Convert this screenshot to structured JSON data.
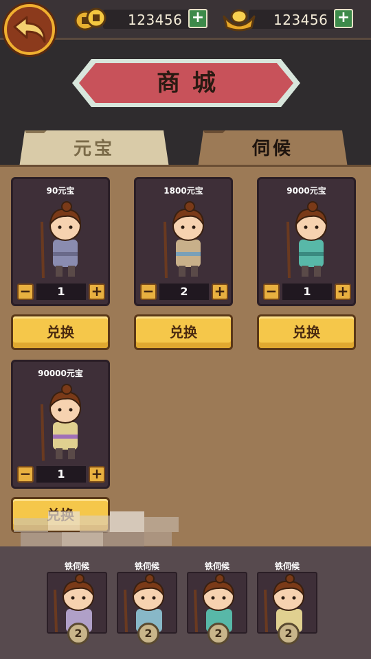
{
  "header": {
    "coins": "123456",
    "ingots": "123456",
    "add_symbol": "+"
  },
  "title": "商城",
  "tabs": [
    {
      "label": "元宝",
      "active": false
    },
    {
      "label": "伺候",
      "active": true
    }
  ],
  "shop": {
    "items": [
      {
        "price": "90元宝",
        "qty": "1",
        "robe": "#8a8cb0",
        "sash": "#6a6a8a"
      },
      {
        "price": "1800元宝",
        "qty": "2",
        "robe": "#c8b08a",
        "sash": "#7aa0b8"
      },
      {
        "price": "9000元宝",
        "qty": "1",
        "robe": "#58b8a8",
        "sash": "#3a8a80"
      },
      {
        "price": "90000元宝",
        "qty": "1",
        "robe": "#e0d090",
        "sash": "#a070b8"
      }
    ],
    "exchange_label": "兑换",
    "minus_symbol": "−",
    "plus_symbol": "+"
  },
  "roster": [
    {
      "name": "铁伺候",
      "level": "2",
      "robe": "#b0a0c8"
    },
    {
      "name": "铁伺候",
      "level": "2",
      "robe": "#88b8c8"
    },
    {
      "name": "铁伺候",
      "level": "2",
      "robe": "#58b8a8"
    },
    {
      "name": "铁伺候",
      "level": "2",
      "robe": "#e0d090"
    }
  ],
  "colors": {
    "accent_gold": "#f5c74a",
    "banner_red": "#c8525a",
    "panel_brown": "#9c7a56"
  }
}
